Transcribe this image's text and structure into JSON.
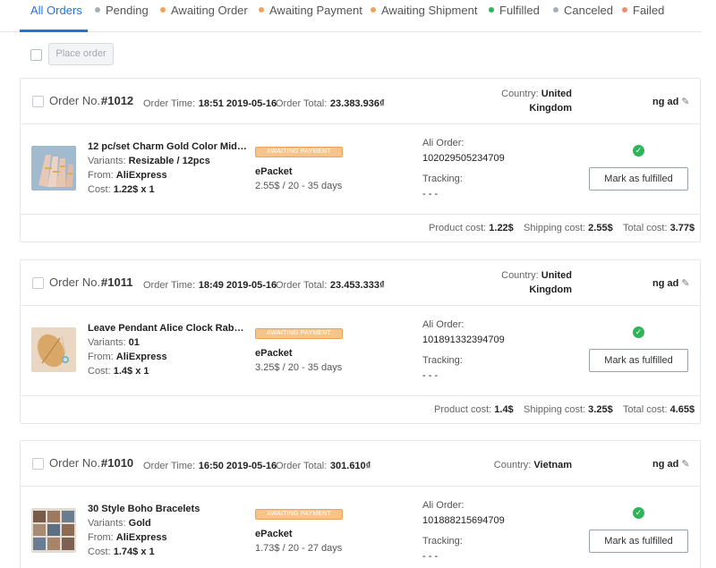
{
  "tabs": [
    {
      "label": "All Orders",
      "dot": null,
      "active": true
    },
    {
      "label": "Pending",
      "dot": "#aab0b8"
    },
    {
      "label": "Awaiting Order",
      "dot": "#f0a35a"
    },
    {
      "label": "Awaiting Payment",
      "dot": "#f0a35a"
    },
    {
      "label": "Awaiting Shipment",
      "dot": "#f0a35a"
    },
    {
      "label": "Fulfilled",
      "dot": "#2fb45a"
    },
    {
      "label": "Canceled",
      "dot": "#aab0b8"
    },
    {
      "label": "Failed",
      "dot": "#ef8e6a"
    }
  ],
  "toolbar": {
    "place_order_label": "Place order"
  },
  "labels": {
    "order_no": "Order No.:",
    "order_time": "Order Time:",
    "order_total": "Order Total:",
    "country": "Country:",
    "variants": "Variants:",
    "from": "From:",
    "cost": "Cost:",
    "ali_order": "Ali Order:",
    "tracking": "Tracking:",
    "product_cost": "Product cost:",
    "shipping_cost": "Shipping cost:",
    "total_cost": "Total cost:",
    "mark_fulfilled": "Mark as fulfilled",
    "status_badge": "AWAITING PAYMENT"
  },
  "orders": [
    {
      "number": "#1012",
      "time": "18:51 2019-05-16",
      "total": "23.383.936₫",
      "country_line1": "United",
      "country_line2": "Kingdom",
      "store": "ng ad",
      "product_name": "12 pc/set Charm Gold Color Midi Fi...",
      "variants": "Resizable / 12pcs",
      "from": "AliExpress",
      "cost": "1.22$ x 1",
      "shipping_method": "ePacket",
      "shipping_detail": "2.55$ / 20 - 35 days",
      "ali_order": "102029505234709",
      "tracking": "- - -",
      "product_cost": "1.22$",
      "shipping_cost": "2.55$",
      "total_cost": "3.77$"
    },
    {
      "number": "#1011",
      "time": "18:49 2019-05-16",
      "total": "23.453.333₫",
      "country_line1": "United",
      "country_line2": "Kingdom",
      "store": "ng ad",
      "product_name": "Leave Pendant Alice Clock Rabbit ...",
      "variants": "01",
      "from": "AliExpress",
      "cost": "1.4$ x 1",
      "shipping_method": "ePacket",
      "shipping_detail": "3.25$ / 20 - 35 days",
      "ali_order": "101891332394709",
      "tracking": "- - -",
      "product_cost": "1.4$",
      "shipping_cost": "3.25$",
      "total_cost": "4.65$"
    },
    {
      "number": "#1010",
      "time": "16:50 2019-05-16",
      "total": "301.610₫",
      "country_line1": "Vietnam",
      "country_line2": "",
      "store": "ng ad",
      "product_name": "30 Style Boho Bracelets",
      "variants": "Gold",
      "from": "AliExpress",
      "cost": "1.74$ x 1",
      "shipping_method": "ePacket",
      "shipping_detail": "1.73$ / 20 - 27 days",
      "ali_order": "101888215694709",
      "tracking": "- - -"
    }
  ]
}
